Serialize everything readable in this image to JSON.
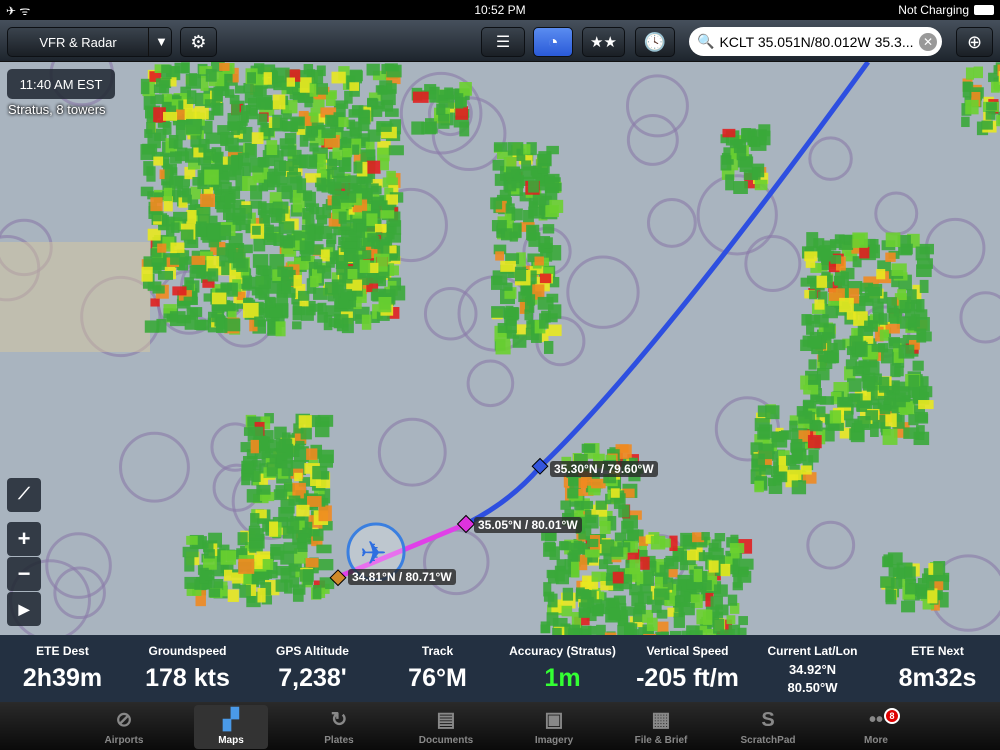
{
  "status_bar": {
    "time": "10:52 PM",
    "charging": "Not Charging"
  },
  "toolbar": {
    "layer_select": "VFR & Radar",
    "search_value": "KCLT 35.051N/80.012W 35.3..."
  },
  "map": {
    "time_label": "11:40 AM EST",
    "source_label": "Stratus, 8 towers",
    "waypoints": [
      {
        "label": "35.30°N / 79.60°W",
        "color": "#3355dd"
      },
      {
        "label": "35.05°N / 80.01°W",
        "color": "#dd33dd"
      },
      {
        "label": "34.81°N / 80.71°W",
        "color": "#d08a2a"
      }
    ],
    "route_colors": {
      "active": "#e040e8",
      "remaining": "#2e4fe0"
    }
  },
  "instruments": [
    {
      "label": "ETE Dest",
      "value": "2h39m"
    },
    {
      "label": "Groundspeed",
      "value": "178 kts"
    },
    {
      "label": "GPS Altitude",
      "value": "7,238'"
    },
    {
      "label": "Track",
      "value": "76°M"
    },
    {
      "label": "Accuracy (Stratus)",
      "value": "1m",
      "color": "#33ff33"
    },
    {
      "label": "Vertical Speed",
      "value": "-205 ft/m"
    },
    {
      "label": "Current Lat/Lon",
      "lat": "34.92°N",
      "lon": "80.50°W"
    },
    {
      "label": "ETE Next",
      "value": "8m32s"
    }
  ],
  "tabs": [
    {
      "label": "Airports",
      "icon": "airport-icon"
    },
    {
      "label": "Maps",
      "icon": "maps-icon",
      "selected": true
    },
    {
      "label": "Plates",
      "icon": "plates-icon"
    },
    {
      "label": "Documents",
      "icon": "documents-icon"
    },
    {
      "label": "Imagery",
      "icon": "imagery-icon"
    },
    {
      "label": "File & Brief",
      "icon": "file-brief-icon"
    },
    {
      "label": "ScratchPad",
      "icon": "scratchpad-icon"
    },
    {
      "label": "More",
      "icon": "more-icon",
      "badge": "8"
    }
  ]
}
